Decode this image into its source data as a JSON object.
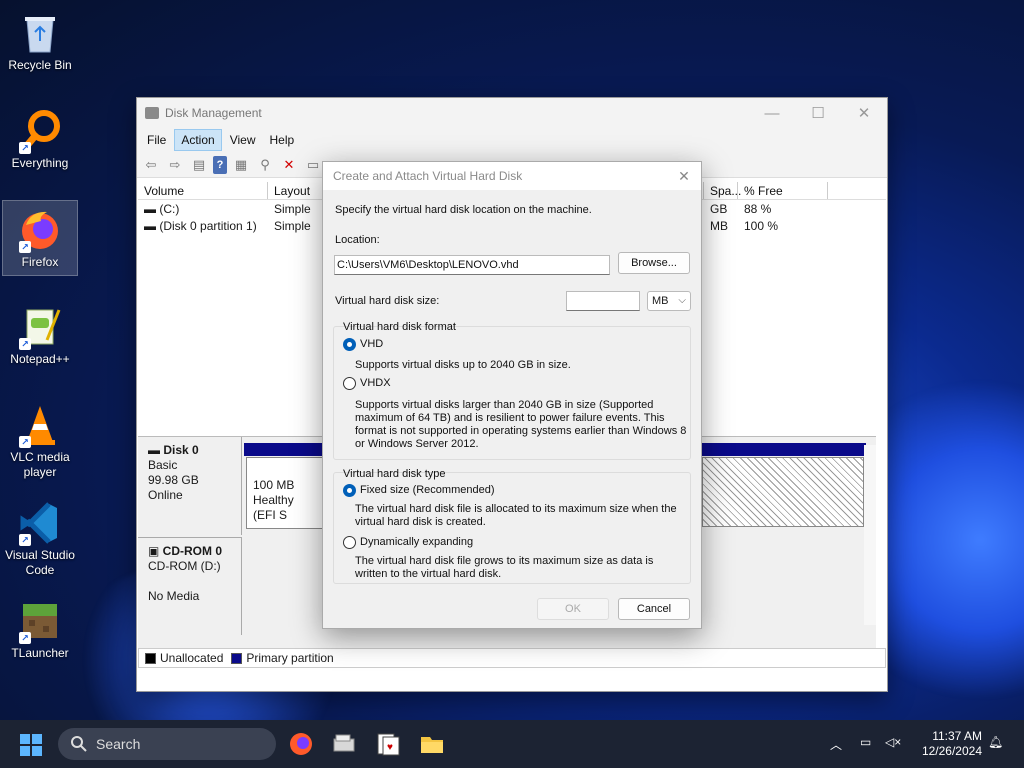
{
  "desktop": {
    "icons": [
      {
        "label": "Recycle Bin",
        "icon": "recycle-bin-icon"
      },
      {
        "label": "Everything",
        "icon": "everything-icon"
      },
      {
        "label": "Firefox",
        "icon": "firefox-icon"
      },
      {
        "label": "Notepad++",
        "icon": "notepadpp-icon"
      },
      {
        "label": "VLC media player",
        "icon": "vlc-icon"
      },
      {
        "label": "Visual Studio Code",
        "icon": "vscode-icon"
      },
      {
        "label": "TLauncher",
        "icon": "tlauncher-icon"
      }
    ]
  },
  "disk_management": {
    "title": "Disk Management",
    "menu": [
      "File",
      "Action",
      "View",
      "Help"
    ],
    "active_menu": "Action",
    "columns": [
      "Volume",
      "Layout",
      "Spa...",
      "% Free"
    ],
    "volumes": [
      {
        "volume": "(C:)",
        "layout": "Simple",
        "space": "GB",
        "free": "88 %"
      },
      {
        "volume": "(Disk 0 partition 1)",
        "layout": "Simple",
        "space": "MB",
        "free": "100 %"
      }
    ],
    "disk0": {
      "name": "Disk 0",
      "type": "Basic",
      "size": "99.98 GB",
      "status": "Online",
      "partition_size": "100 MB",
      "partition_status": "Healthy (EFI S"
    },
    "cdrom0": {
      "name": "CD-ROM 0",
      "drive": "CD-ROM (D:)",
      "media": "No Media"
    },
    "legend": [
      {
        "label": "Unallocated",
        "color": "#000000"
      },
      {
        "label": "Primary partition",
        "color": "#0a0a8a"
      }
    ]
  },
  "dialog": {
    "title": "Create and Attach Virtual Hard Disk",
    "instruction": "Specify the virtual hard disk location on the machine.",
    "location_label": "Location:",
    "location_value": "C:\\Users\\VM6\\Desktop\\LENOVO.vhd",
    "browse_label": "Browse...",
    "size_label": "Virtual hard disk size:",
    "size_value": "",
    "size_unit": "MB",
    "format_group": "Virtual hard disk format",
    "vhd_label": "VHD",
    "vhd_desc": "Supports virtual disks up to 2040 GB in size.",
    "vhdx_label": "VHDX",
    "vhdx_desc": "Supports virtual disks larger than 2040 GB in size (Supported maximum of 64 TB) and is resilient to power failure events. This format is not supported in operating systems earlier than Windows 8 or Windows Server 2012.",
    "type_group": "Virtual hard disk type",
    "fixed_label": "Fixed size (Recommended)",
    "fixed_desc": "The virtual hard disk file is allocated to its maximum size when the virtual hard disk is created.",
    "dynamic_label": "Dynamically expanding",
    "dynamic_desc": "The virtual hard disk file grows to its maximum size as data is written to the virtual hard disk.",
    "ok_label": "OK",
    "cancel_label": "Cancel"
  },
  "taskbar": {
    "search_label": "Search",
    "time": "11:37 AM",
    "date": "12/26/2024"
  }
}
